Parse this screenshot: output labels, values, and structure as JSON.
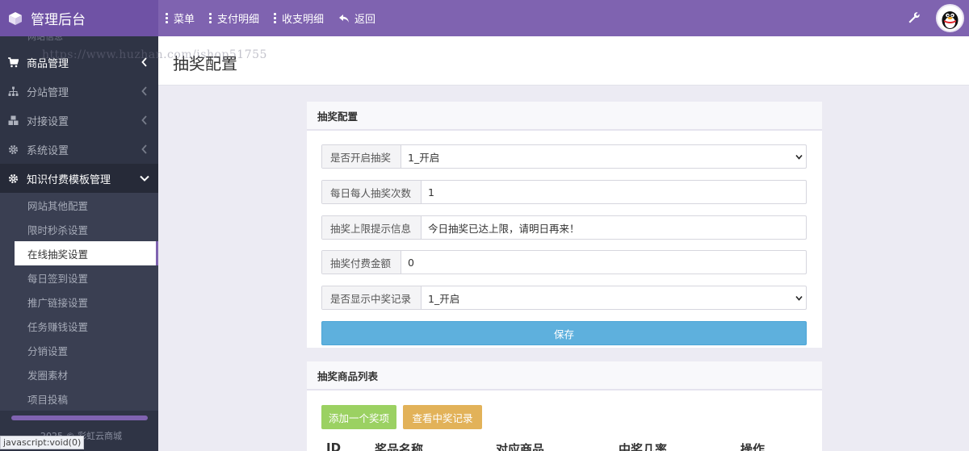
{
  "header": {
    "brand_title": "管理后台",
    "nav": [
      {
        "label": "菜单"
      },
      {
        "label": "支付明细"
      },
      {
        "label": "收支明细"
      },
      {
        "label": "返回"
      }
    ]
  },
  "watermark": "https://www.huzhan.com/ishop51755",
  "sidebar": {
    "partial_top": "网站信息",
    "items": [
      {
        "label": "商品管理"
      },
      {
        "label": "分站管理"
      },
      {
        "label": "对接设置"
      },
      {
        "label": "系统设置"
      },
      {
        "label": "知识付费模板管理"
      }
    ],
    "sub_items": [
      {
        "label": "网站其他配置"
      },
      {
        "label": "限时秒杀设置"
      },
      {
        "label": "在线抽奖设置"
      },
      {
        "label": "每日签到设置"
      },
      {
        "label": "推广链接设置"
      },
      {
        "label": "任务赚钱设置"
      },
      {
        "label": "分销设置"
      },
      {
        "label": "发圈素材"
      },
      {
        "label": "项目投稿"
      }
    ],
    "footer": "2025 © 彩虹云商城"
  },
  "statusbar": "javascript:void(0)",
  "page": {
    "title": "抽奖配置"
  },
  "config_card": {
    "title": "抽奖配置",
    "fields": [
      {
        "label": "是否开启抽奖",
        "value": "1_开启",
        "type": "select"
      },
      {
        "label": "每日每人抽奖次数",
        "value": "1",
        "type": "input"
      },
      {
        "label": "抽奖上限提示信息",
        "value": "今日抽奖已达上限，请明日再来！",
        "type": "input"
      },
      {
        "label": "抽奖付费金额",
        "value": "0",
        "type": "input"
      },
      {
        "label": "是否显示中奖记录",
        "value": "1_开启",
        "type": "select"
      }
    ],
    "save_label": "保存"
  },
  "prize_card": {
    "title": "抽奖商品列表",
    "add_label": "添加一个奖项",
    "view_label": "查看中奖记录",
    "columns": [
      "ID",
      "奖品名称",
      "对应商品",
      "中奖几率",
      "操作"
    ]
  },
  "colors": {
    "topbar": "#7f63b0",
    "sidebar": "#2f3445",
    "save_button": "#5eb0dd",
    "add_button": "#9bd162",
    "view_button": "#e2b259"
  }
}
